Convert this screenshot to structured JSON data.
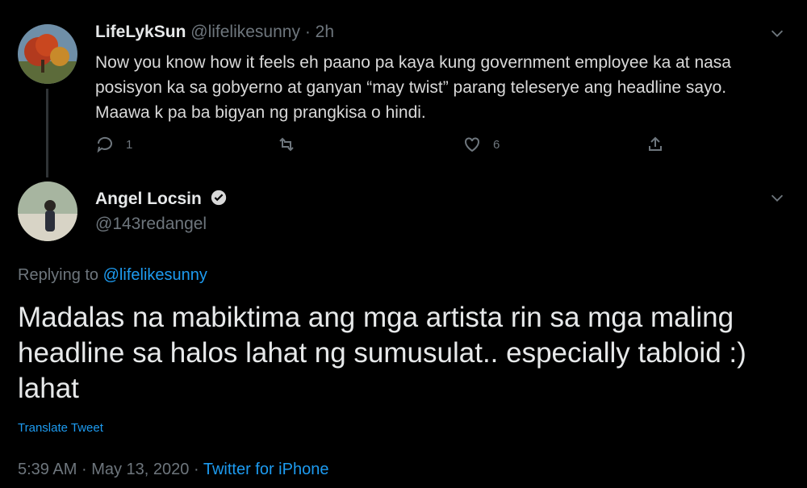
{
  "reply": {
    "author_name": "LifeLykSun",
    "author_handle": "@lifelikesunny",
    "time": "2h",
    "separator": "·",
    "text": "Now you know how it feels eh paano pa kaya kung government employee ka at nasa posisyon ka sa gobyerno at ganyan “may twist” parang teleserye ang headline sayo. Maawa k pa ba bigyan ng prangkisa o hindi.",
    "replies_count": "1",
    "likes_count": "6",
    "avatar_icon": "autumn-tree-photo"
  },
  "main_tweet": {
    "author_name": "Angel Locsin",
    "author_handle": "@143redangel",
    "replying_prefix": "Replying to",
    "replying_to": "@lifelikesunny",
    "text": "Madalas na mabiktima ang mga artista rin sa mga maling headline sa halos lahat ng sumusulat.. especially tabloid :) lahat",
    "translate_label": "Translate Tweet",
    "time": "5:39 AM",
    "date": "May 13, 2020",
    "source": "Twitter for iPhone",
    "separator": "·",
    "verified_icon": "verified-badge-icon"
  },
  "colors": {
    "background": "#000000",
    "link": "#1d9bf0",
    "muted": "#6e767d",
    "text": "#e7e9ea"
  }
}
